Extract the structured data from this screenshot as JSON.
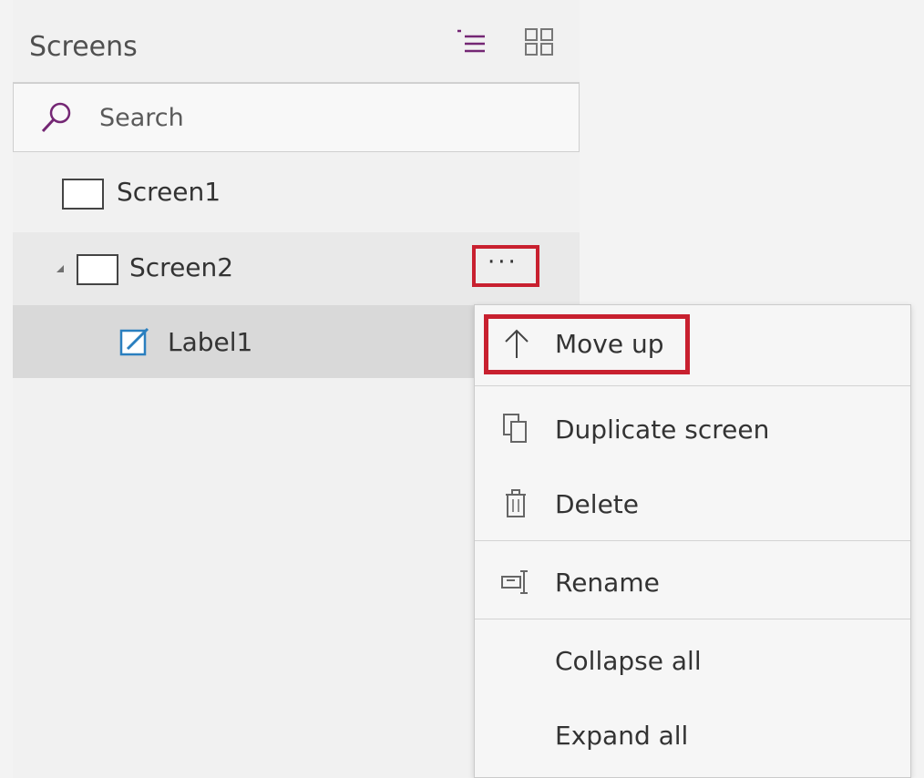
{
  "panel": {
    "title": "Screens",
    "icons": {
      "tree_view": "tree-list-icon",
      "thumbnail_view": "grid-icon"
    }
  },
  "search": {
    "placeholder": "Search",
    "icon": "search-icon"
  },
  "tree": {
    "items": [
      {
        "label": "Screen1",
        "icon": "screen-icon"
      },
      {
        "label": "Screen2",
        "icon": "screen-icon",
        "expanded": true,
        "more_label": "···"
      },
      {
        "label": "Label1",
        "icon": "label-edit-icon"
      }
    ]
  },
  "context_menu": {
    "items": [
      {
        "label": "Move up",
        "icon": "arrow-up-icon"
      },
      {
        "label": "Duplicate screen",
        "icon": "duplicate-icon"
      },
      {
        "label": "Delete",
        "icon": "trash-icon"
      },
      {
        "label": "Rename",
        "icon": "rename-icon"
      },
      {
        "label": "Collapse all",
        "icon": ""
      },
      {
        "label": "Expand all",
        "icon": ""
      }
    ]
  },
  "colors": {
    "highlight": "#c8202f",
    "accent": "#742774"
  }
}
